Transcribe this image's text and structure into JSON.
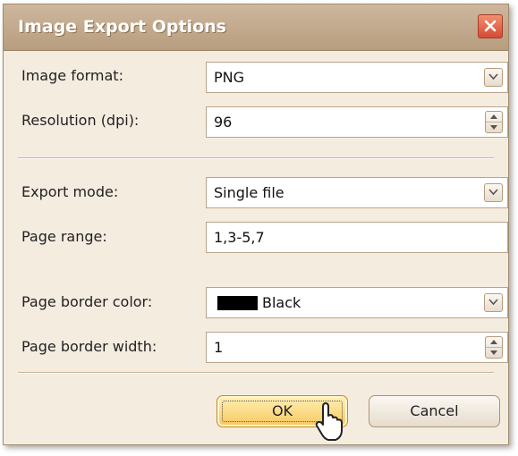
{
  "dialog": {
    "title": "Image Export Options",
    "close_icon": "close-icon"
  },
  "fields": {
    "image_format": {
      "label": "Image format:",
      "value": "PNG"
    },
    "resolution": {
      "label": "Resolution (dpi):",
      "value": "96"
    },
    "export_mode": {
      "label": "Export mode:",
      "value": "Single file"
    },
    "page_range": {
      "label": "Page range:",
      "value": "1,3-5,7"
    },
    "border_color": {
      "label": "Page border color:",
      "value": "Black",
      "swatch_color": "#000000"
    },
    "border_width": {
      "label": "Page border width:",
      "value": "1"
    }
  },
  "buttons": {
    "ok": "OK",
    "cancel": "Cancel"
  },
  "theme": {
    "accent": "#f7c75e",
    "title_bar": "#c4aa8c",
    "close": "#d64a34"
  }
}
